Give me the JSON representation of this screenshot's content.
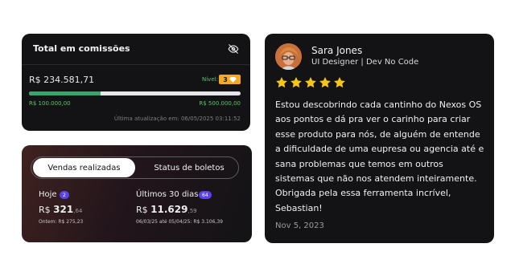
{
  "commissions": {
    "title": "Total em comissões",
    "amount": "R$ 234.581,71",
    "level_label": "Nível:",
    "level_value": "3",
    "progress_fraction": 0.34,
    "min_label": "R$ 100.000,00",
    "max_label": "R$ 500.000,00",
    "updated": "Última atualização em: 06/05/2025 03:11:52",
    "colors": {
      "progress": "#38a66a",
      "level_badge": "#f4a828",
      "accent_text": "#59c466"
    }
  },
  "sales": {
    "tabs": [
      {
        "label": "Vendas realizadas",
        "active": true
      },
      {
        "label": "Status de boletos",
        "active": false
      }
    ],
    "today": {
      "label": "Hoje",
      "count": "2",
      "currency": "R$",
      "value_main": "321",
      "value_cents": ",64",
      "sub": "Ontem: R$ 275,23"
    },
    "last30": {
      "label": "Últimos 30 dias",
      "count": "64",
      "currency": "R$",
      "value_main": "11.629",
      "value_cents": ",59",
      "sub": "06/03/25 até 05/04/25: R$ 3.106,39"
    },
    "colors": {
      "badge": "#5a43e8"
    }
  },
  "review": {
    "name": "Sara Jones",
    "role": "UI Designer | Dev No Code",
    "rating": 5,
    "text": "Estou descobrindo cada cantinho do Nexos OS aos pontos e dá pra ver o carinho para criar esse produto para nós, de alguém de entende a dificuldade de uma eupresa ou agencia até e sana problemas que temos em outros sistemas que não nos atendem inteiramente. Obrigada pela essa ferramenta incrível, Sebastian!",
    "date": "Nov 5, 2023",
    "colors": {
      "stars": "#f6c51a"
    }
  }
}
